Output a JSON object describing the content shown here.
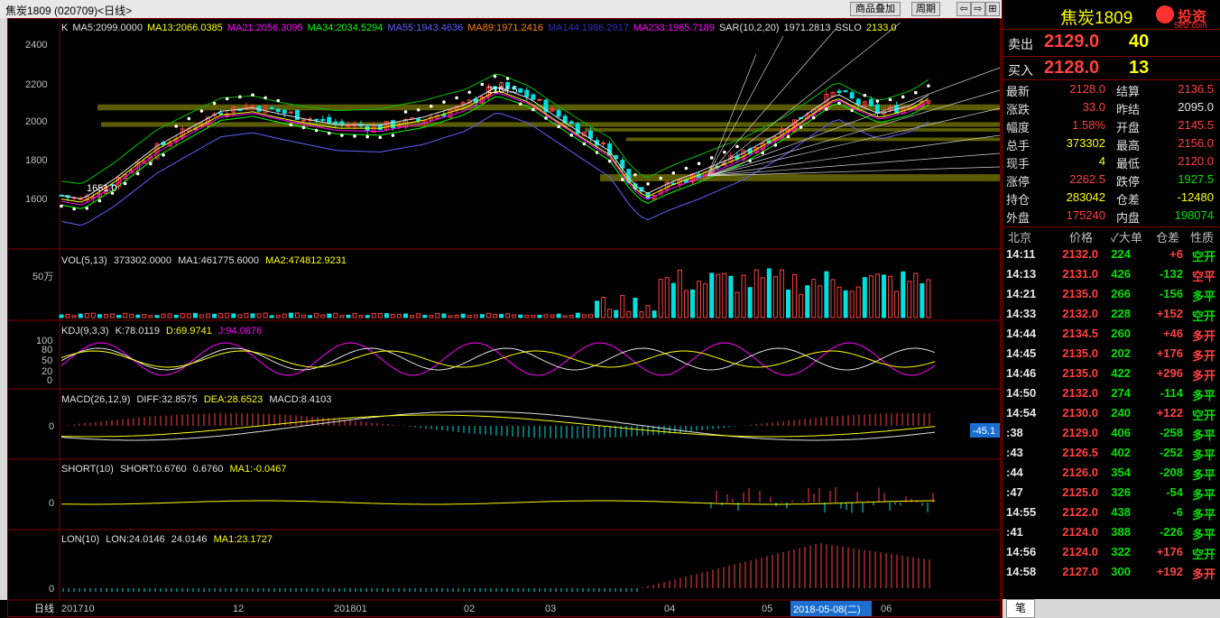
{
  "title_bar": {
    "symbol_info": "焦炭1809 (020709)<日线>",
    "overlay_label": "商品叠加",
    "period_label": "周期",
    "btn_prev": "⇦",
    "btn_next": "⇨",
    "btn_grid": "⊞"
  },
  "main_panel": {
    "ma_items": [
      {
        "text": "K",
        "color": "#e0e0e0"
      },
      {
        "text": "MA5:2099.0000",
        "color": "#e0e0e0"
      },
      {
        "text": "MA13:2066.0385",
        "color": "#ffff00"
      },
      {
        "text": "MA21:2056.3095",
        "color": "#ff00ff"
      },
      {
        "text": "MA34:2034.5294",
        "color": "#00ff00"
      },
      {
        "text": "MA55:1943.4636",
        "color": "#6060ff"
      },
      {
        "text": "MA89:1971.2416",
        "color": "#ff8000"
      },
      {
        "text": "MA144:1986.2917",
        "color": "#3030c0"
      },
      {
        "text": "MA233:1965.7189",
        "color": "#ff00ff"
      },
      {
        "text": "SAR(10,2,20)",
        "color": "#e0e0e0"
      },
      {
        "text": "1971.2813",
        "color": "#e0e0e0"
      },
      {
        "text": "SSLO",
        "color": "#e0e0e0"
      },
      {
        "text": "2133.0",
        "color": "#ffff00"
      }
    ],
    "y_ticks": [
      "2400",
      "2200",
      "2000",
      "1800",
      "1600"
    ],
    "high_label": "2164.5",
    "low_label": "1651.0"
  },
  "vol_panel": {
    "label": "VOL(5,13)",
    "value": "373302.0000",
    "ma1": "MA1:461775.6000",
    "ma2": "MA2:474812.9231",
    "y_tick": "50万"
  },
  "kdj_panel": {
    "label": "KDJ(9,3,3)",
    "k": "K:78.0119",
    "d": "D:69.9741",
    "j": "J:94.0876",
    "y_ticks": [
      "100",
      "80",
      "50",
      "20",
      "0"
    ]
  },
  "macd_panel": {
    "label": "MACD(26,12,9)",
    "diff": "DIFF:32.8575",
    "dea": "DEA:28.6523",
    "macd": "MACD:8.4103",
    "y_tick": "0",
    "price_tag": "-45.1"
  },
  "short_panel": {
    "label": "SHORT(10)",
    "value": "SHORT:0.6760",
    "value2": "0.6760",
    "ma1": "MA1:-0.0467",
    "y_tick": "0"
  },
  "lon_panel": {
    "label": "LON(10)",
    "value": "LON:24.0146",
    "value2": "24.0146",
    "ma1": "MA1:23.1727",
    "y_tick": "0"
  },
  "x_axis": {
    "period": "日线",
    "labels": [
      "201710",
      "12",
      "201801",
      "02",
      "03",
      "04",
      "05",
      "06"
    ],
    "cursor_date": "2018-05-08(二)"
  },
  "quote": {
    "name": "焦炭1809",
    "logo_text": "投资",
    "logo_url": "5etz.com",
    "sell": {
      "label": "卖出",
      "price": "2129.0",
      "vol": "40"
    },
    "buy": {
      "label": "买入",
      "price": "2128.0",
      "vol": "13"
    },
    "stats": [
      {
        "l1": "最新",
        "v1": "2128.0",
        "c1": "red",
        "l2": "结算",
        "v2": "2136.5",
        "c2": "red"
      },
      {
        "l1": "涨跌",
        "v1": "33.0",
        "c1": "red",
        "l2": "昨结",
        "v2": "2095.0",
        "c2": "wht"
      },
      {
        "l1": "幅度",
        "v1": "1.58%",
        "c1": "red",
        "l2": "开盘",
        "v2": "2145.5",
        "c2": "red"
      },
      {
        "l1": "总手",
        "v1": "373302",
        "c1": "yel",
        "l2": "最高",
        "v2": "2156.0",
        "c2": "red"
      },
      {
        "l1": "现手",
        "v1": "4",
        "c1": "yel",
        "l2": "最低",
        "v2": "2120.0",
        "c2": "red"
      },
      {
        "l1": "涨停",
        "v1": "2262.5",
        "c1": "red",
        "l2": "跌停",
        "v2": "1927.5",
        "c2": "grn"
      },
      {
        "l1": "持仓",
        "v1": "283042",
        "c1": "yel",
        "l2": "仓差",
        "v2": "-12480",
        "c2": "yel"
      },
      {
        "l1": "外盘",
        "v1": "175240",
        "c1": "red",
        "l2": "内盘",
        "v2": "198074",
        "c2": "grn"
      }
    ],
    "ticks_header": [
      "北京",
      "价格",
      "✓大单",
      "仓差",
      "性质"
    ],
    "ticks": [
      {
        "time": "14:11",
        "price": "2132.0",
        "vol": "224",
        "diff": "+6",
        "nature": "空开",
        "nc": "grn"
      },
      {
        "time": "14:13",
        "price": "2131.0",
        "vol": "426",
        "diff": "-132",
        "nature": "空平",
        "nc": "red"
      },
      {
        "time": "14:21",
        "price": "2135.0",
        "vol": "266",
        "diff": "-156",
        "nature": "多平",
        "nc": "grn"
      },
      {
        "time": "14:33",
        "price": "2132.0",
        "vol": "228",
        "diff": "+152",
        "nature": "空开",
        "nc": "grn"
      },
      {
        "time": "14:44",
        "price": "2134.5",
        "vol": "260",
        "diff": "+46",
        "nature": "多开",
        "nc": "red"
      },
      {
        "time": "14:45",
        "price": "2135.0",
        "vol": "202",
        "diff": "+176",
        "nature": "多开",
        "nc": "red"
      },
      {
        "time": "14:46",
        "price": "2135.0",
        "vol": "422",
        "diff": "+296",
        "nature": "多开",
        "nc": "red"
      },
      {
        "time": "14:50",
        "price": "2132.0",
        "vol": "274",
        "diff": "-114",
        "nature": "多平",
        "nc": "grn"
      },
      {
        "time": "14:54",
        "price": "2130.0",
        "vol": "240",
        "diff": "+122",
        "nature": "空开",
        "nc": "grn"
      },
      {
        "time": ":38",
        "price": "2129.0",
        "vol": "406",
        "diff": "-258",
        "nature": "多平",
        "nc": "grn"
      },
      {
        "time": ":43",
        "price": "2126.5",
        "vol": "402",
        "diff": "-252",
        "nature": "多平",
        "nc": "grn"
      },
      {
        "time": ":44",
        "price": "2126.0",
        "vol": "354",
        "diff": "-208",
        "nature": "多平",
        "nc": "grn"
      },
      {
        "time": ":47",
        "price": "2125.0",
        "vol": "326",
        "diff": "-54",
        "nature": "多平",
        "nc": "grn"
      },
      {
        "time": "14:55",
        "price": "2122.0",
        "vol": "438",
        "diff": "-6",
        "nature": "多平",
        "nc": "grn"
      },
      {
        "time": ":41",
        "price": "2124.0",
        "vol": "388",
        "diff": "-226",
        "nature": "多平",
        "nc": "grn"
      },
      {
        "time": "14:56",
        "price": "2124.0",
        "vol": "322",
        "diff": "+176",
        "nature": "空开",
        "nc": "grn"
      },
      {
        "time": "14:58",
        "price": "2127.0",
        "vol": "300",
        "diff": "+192",
        "nature": "多开",
        "nc": "red"
      }
    ],
    "bottom_tab": "笔"
  },
  "colors": {
    "up": "#ff4040",
    "down": "#00e0e0",
    "band": "#6b6b00",
    "grid": "#800000"
  }
}
